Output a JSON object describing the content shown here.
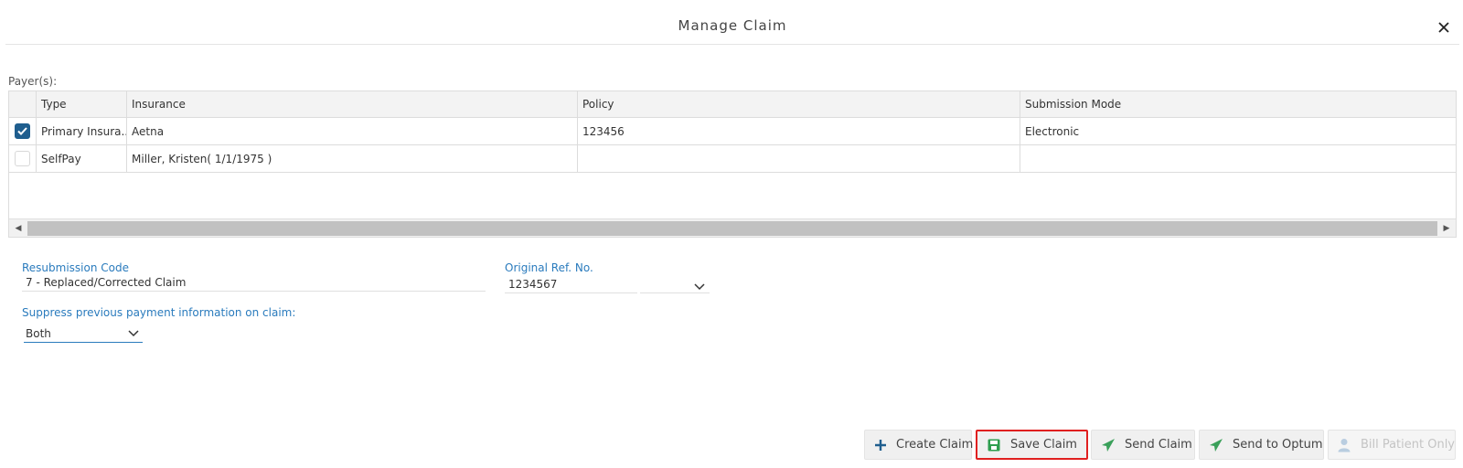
{
  "dialog": {
    "title": "Manage Claim"
  },
  "payers": {
    "label": "Payer(s):",
    "columns": [
      "Type",
      "Insurance",
      "Policy",
      "Submission Mode"
    ],
    "rows": [
      {
        "checked": true,
        "type": "Primary Insura...",
        "insurance": "Aetna",
        "policy": "123456",
        "submission_mode": "Electronic"
      },
      {
        "checked": false,
        "type": "SelfPay",
        "insurance": "Miller, Kristen( 1/1/1975 )",
        "policy": "",
        "submission_mode": ""
      }
    ]
  },
  "form": {
    "resubmission_code": {
      "label": "Resubmission Code",
      "value": "7 - Replaced/Corrected Claim"
    },
    "original_ref": {
      "label": "Original Ref. No.",
      "value": "1234567"
    },
    "suppress": {
      "label": "Suppress previous payment information on claim:",
      "value": "Both"
    }
  },
  "actions": {
    "create_claim": "Create Claim",
    "save_claim": "Save Claim",
    "send_claim": "Send Claim",
    "send_to_optum": "Send to Optum",
    "bill_patient_only": "Bill Patient Only"
  },
  "icons": {
    "close": "close-icon",
    "create": "plus-icon",
    "save": "save-icon",
    "send": "paper-plane-icon",
    "bill": "user-icon"
  },
  "colors": {
    "accent": "#1f5e8e",
    "label_blue": "#2a7bbd",
    "save_green": "#2e9e4f",
    "send_green": "#3aa05a",
    "highlight_red": "#e02020"
  }
}
